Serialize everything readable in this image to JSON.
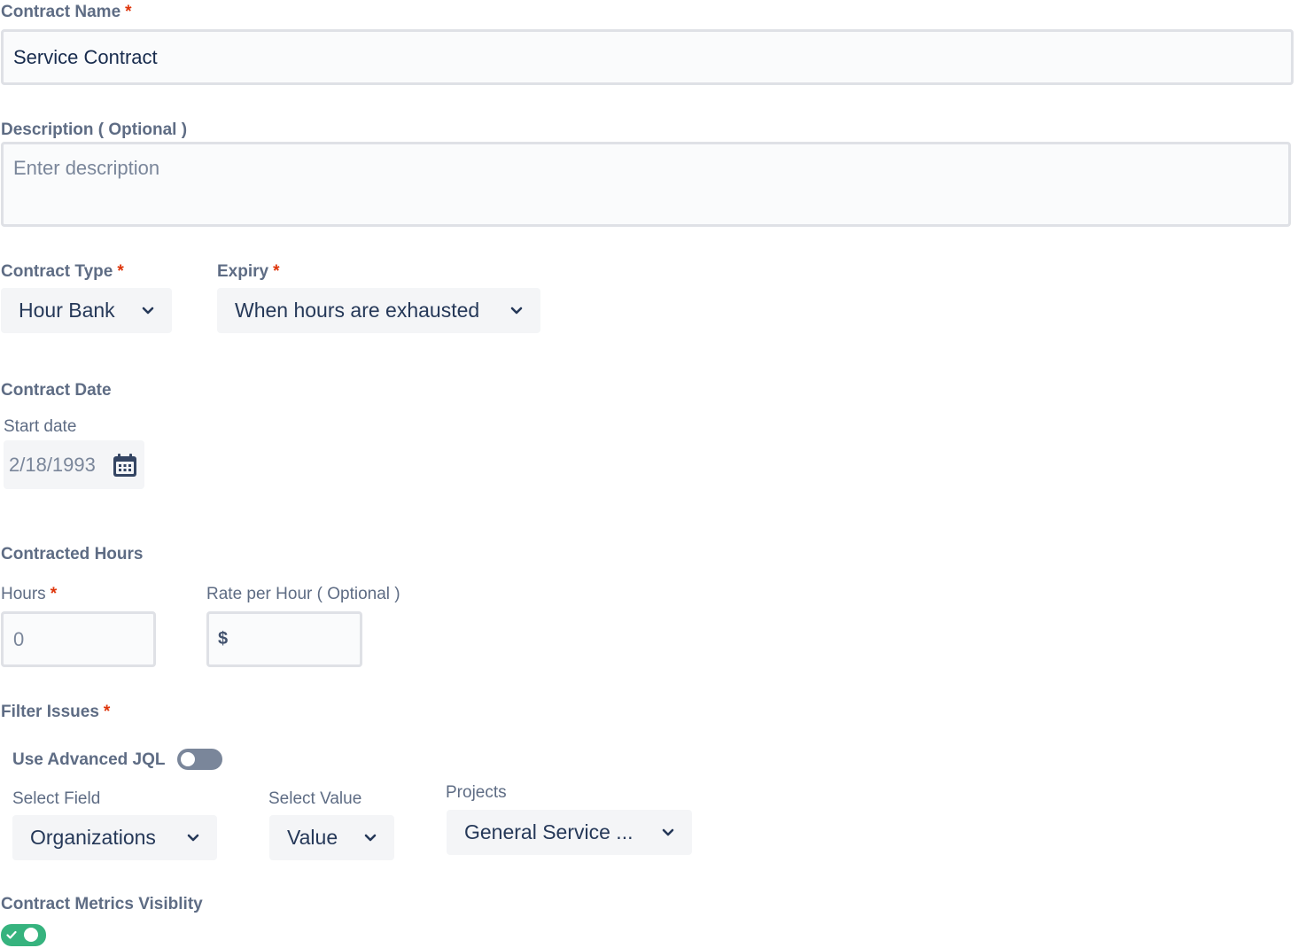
{
  "contract_name": {
    "label": "Contract Name",
    "required_mark": "*",
    "value": "Service Contract"
  },
  "description": {
    "label": "Description ( Optional )",
    "placeholder": "Enter description"
  },
  "contract_type": {
    "label": "Contract Type",
    "required_mark": "*",
    "selected": "Hour Bank"
  },
  "expiry": {
    "label": "Expiry",
    "required_mark": "*",
    "selected": "When hours are exhausted"
  },
  "contract_date": {
    "heading": "Contract Date",
    "start_label": "Start date",
    "start_value": "2/18/1993"
  },
  "contracted_hours": {
    "heading": "Contracted Hours",
    "hours_label": "Hours",
    "hours_required_mark": "*",
    "hours_placeholder": "0",
    "rate_label": "Rate per Hour ( Optional )",
    "currency_symbol": "$"
  },
  "filter_issues": {
    "heading": "Filter Issues",
    "required_mark": "*",
    "advanced_jql_label": "Use Advanced JQL",
    "advanced_jql_enabled": false,
    "select_field_label": "Select Field",
    "select_field_value": "Organizations",
    "select_value_label": "Select Value",
    "select_value_value": "Value",
    "projects_label": "Projects",
    "projects_value": "General Service ..."
  },
  "metrics_visibility": {
    "label": "Contract Metrics Visiblity",
    "enabled": true
  },
  "colors": {
    "required": "#de350b",
    "toggle_on": "#36b37e",
    "toggle_off": "#7a869a",
    "calendar_icon": "#344563"
  },
  "icons": {
    "select_chevron": "chevron-down-icon",
    "date_picker": "calendar-icon",
    "toggle_on_mark": "check-icon"
  }
}
